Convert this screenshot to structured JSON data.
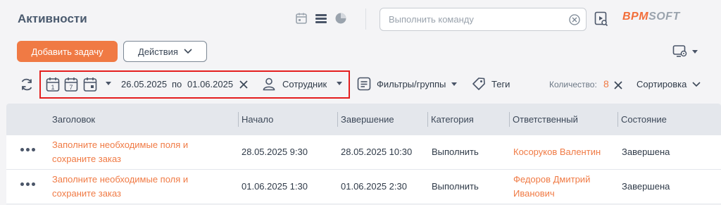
{
  "header": {
    "title": "Активности",
    "command_placeholder": "Выполнить команду",
    "logo_part1": "BPM",
    "logo_part2": "SOFT",
    "view_icons": [
      "calendar-icon",
      "list-icon",
      "pie-chart-icon"
    ]
  },
  "actions": {
    "add_task": "Добавить задачу",
    "actions_menu": "Действия"
  },
  "toolbar": {
    "date_icons": [
      "calendar-day-icon",
      "calendar-week-icon",
      "calendar-month-icon"
    ],
    "day_label": "1",
    "week_label": "7",
    "date_from": "26.05.2025",
    "date_to_word": "по",
    "date_to": "01.06.2025",
    "employee": "Сотрудник",
    "filters": "Фильтры/группы",
    "tags": "Теги",
    "count_label": "Количество:",
    "count_value": "8",
    "sort": "Сортировка",
    "highlight_color": "#e41e1e"
  },
  "table": {
    "columns": [
      "Заголовок",
      "Начало",
      "Завершение",
      "Категория",
      "Ответственный",
      "Состояние"
    ],
    "rows": [
      {
        "title_line1": "Заполните необходимые поля и",
        "title_line2": "сохраните заказ",
        "start": "28.05.2025 9:30",
        "end": "28.05.2025 10:30",
        "category": "Выполнить",
        "owner_line1": "Косоруков Валентин",
        "owner_line2": "",
        "status": "Завершена"
      },
      {
        "title_line1": "Заполните необходимые поля и",
        "title_line2": "сохраните заказ",
        "start": "01.06.2025 1:30",
        "end": "01.06.2025 2:30",
        "category": "Выполнить",
        "owner_line1": "Федоров Дмитрий",
        "owner_line2": "Иванович",
        "status": "Завершена"
      }
    ]
  },
  "colors": {
    "accent": "#f07a44",
    "header_bg": "#e4e7ec",
    "page_bg": "#f4f4f6"
  }
}
